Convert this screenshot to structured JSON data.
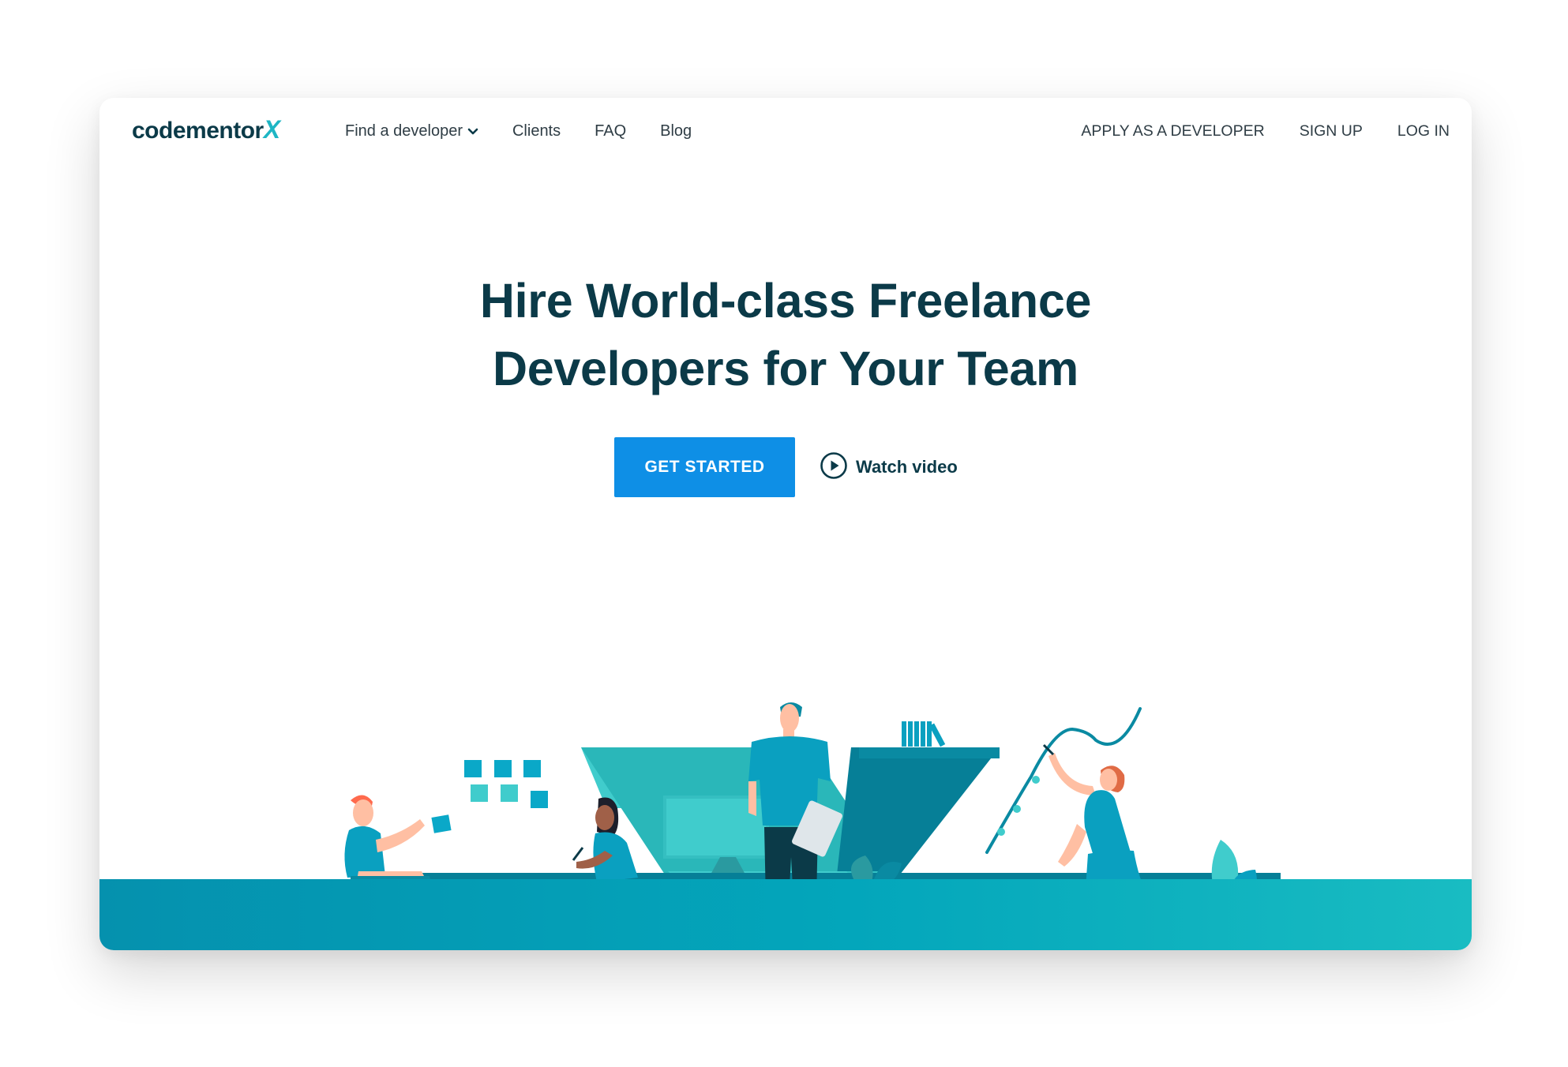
{
  "brand": {
    "logo_text": "codementor",
    "logo_mark": "X"
  },
  "nav": {
    "left": [
      {
        "label": "Find a developer",
        "icon": "chevron-down-icon"
      },
      {
        "label": "Clients"
      },
      {
        "label": "FAQ"
      },
      {
        "label": "Blog"
      }
    ],
    "right": [
      {
        "label": "APPLY AS A DEVELOPER"
      },
      {
        "label": "SIGN UP"
      },
      {
        "label": "LOG IN"
      }
    ]
  },
  "hero": {
    "title_line1": "Hire World-class Freelance",
    "title_line2": "Developers for Your Team",
    "cta_primary": "GET STARTED",
    "cta_secondary": "Watch video",
    "cta_secondary_icon": "play-circle-icon"
  },
  "colors": {
    "primary_text": "#0b3a48",
    "button_blue": "#0e8fe6",
    "teal": "#1eb6c4",
    "ground": "#03a6bb"
  }
}
